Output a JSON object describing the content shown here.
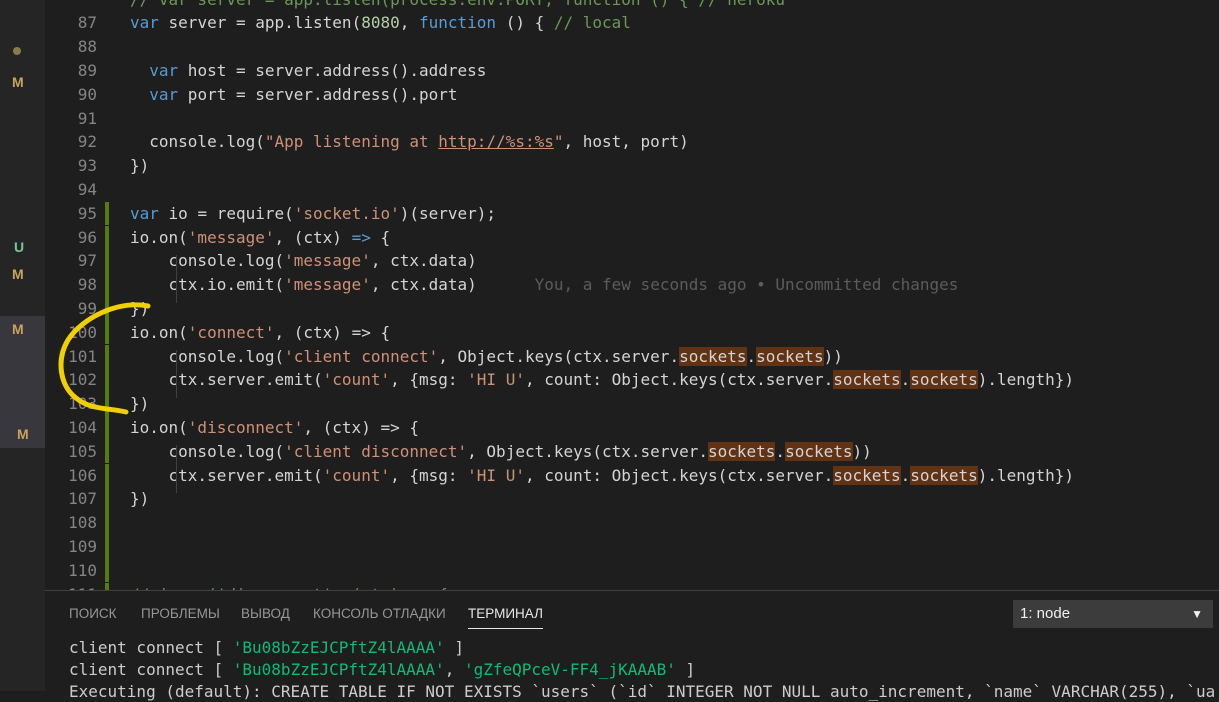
{
  "sidebar": {
    "badges": [
      {
        "label": "M",
        "color": "#c9a25b",
        "kind": "modified"
      },
      {
        "label": "U",
        "color": "#73c991",
        "kind": "untracked"
      },
      {
        "label": "M",
        "color": "#c9a25b",
        "kind": "modified"
      },
      {
        "label": "M",
        "color": "#c9a25b",
        "kind": "modified"
      },
      {
        "label": "M",
        "color": "#c9a25b",
        "kind": "modified"
      }
    ]
  },
  "editor": {
    "lines": [
      {
        "n": "",
        "segs": [
          {
            "t": "// var server = app.listen(process.env.PORT, function () { // heroku",
            "c": "cm"
          }
        ]
      },
      {
        "n": "87",
        "segs": [
          {
            "t": "var",
            "c": "kw"
          },
          {
            "t": " server = app.listen("
          },
          {
            "t": "8080",
            "c": "num"
          },
          {
            "t": ", "
          },
          {
            "t": "function",
            "c": "kw"
          },
          {
            "t": " () { "
          },
          {
            "t": "// local",
            "c": "cm"
          }
        ]
      },
      {
        "n": "88",
        "segs": []
      },
      {
        "n": "89",
        "segs": [
          {
            "t": "  "
          },
          {
            "t": "var",
            "c": "kw"
          },
          {
            "t": " host = server.address().address"
          }
        ]
      },
      {
        "n": "90",
        "segs": [
          {
            "t": "  "
          },
          {
            "t": "var",
            "c": "kw"
          },
          {
            "t": " port = server.address().port"
          }
        ]
      },
      {
        "n": "91",
        "segs": []
      },
      {
        "n": "92",
        "segs": [
          {
            "t": "  console.log("
          },
          {
            "t": "\"App listening at ",
            "c": "str"
          },
          {
            "t": "http://%s:%s",
            "c": "url"
          },
          {
            "t": "\"",
            "c": "str"
          },
          {
            "t": ", host, port)"
          }
        ]
      },
      {
        "n": "93",
        "segs": [
          {
            "t": "})"
          }
        ]
      },
      {
        "n": "94",
        "segs": []
      },
      {
        "n": "95",
        "segs": [
          {
            "t": "var",
            "c": "kw"
          },
          {
            "t": " io = require("
          },
          {
            "t": "'socket.io'",
            "c": "str"
          },
          {
            "t": ")(server);"
          }
        ],
        "gutter": true
      },
      {
        "n": "96",
        "segs": [
          {
            "t": "io.on("
          },
          {
            "t": "'message'",
            "c": "str"
          },
          {
            "t": ", (ctx) "
          },
          {
            "t": "=>",
            "c": "kw"
          },
          {
            "t": " {"
          }
        ],
        "gutter": true
      },
      {
        "n": "97",
        "segs": [
          {
            "t": "    console.log("
          },
          {
            "t": "'message'",
            "c": "str"
          },
          {
            "t": ", ctx.data)"
          }
        ],
        "gutter": true
      },
      {
        "n": "98",
        "segs": [
          {
            "t": "    ctx.io.emit("
          },
          {
            "t": "'message'",
            "c": "str"
          },
          {
            "t": ", ctx.data)"
          },
          {
            "t": "      You, a few seconds ago • Uncommitted changes",
            "c": "blame"
          }
        ],
        "gutter": true
      },
      {
        "n": "99",
        "segs": [
          {
            "t": "})"
          }
        ],
        "gutter": true
      },
      {
        "n": "100",
        "segs": [
          {
            "t": "io.on("
          },
          {
            "t": "'connect'",
            "c": "str"
          },
          {
            "t": ", (ctx) => {"
          }
        ],
        "gutter": true
      },
      {
        "n": "101",
        "segs": [
          {
            "t": "    console.log("
          },
          {
            "t": "'client connect'",
            "c": "str"
          },
          {
            "t": ", Object.keys(ctx.server."
          },
          {
            "t": "sockets",
            "c": "hl"
          },
          {
            "t": "."
          },
          {
            "t": "sockets",
            "c": "hl"
          },
          {
            "t": "))"
          }
        ],
        "gutter": true
      },
      {
        "n": "102",
        "segs": [
          {
            "t": "    ctx.server.emit("
          },
          {
            "t": "'count'",
            "c": "str"
          },
          {
            "t": ", {msg: "
          },
          {
            "t": "'HI U'",
            "c": "str"
          },
          {
            "t": ", count: Object.keys(ctx.server."
          },
          {
            "t": "sockets",
            "c": "hl"
          },
          {
            "t": "."
          },
          {
            "t": "sockets",
            "c": "hl"
          },
          {
            "t": ").length})"
          }
        ],
        "gutter": true
      },
      {
        "n": "103",
        "segs": [
          {
            "t": "})"
          }
        ],
        "gutter": true
      },
      {
        "n": "104",
        "segs": [
          {
            "t": "io.on("
          },
          {
            "t": "'disconnect'",
            "c": "str"
          },
          {
            "t": ", (ctx) => {"
          }
        ],
        "gutter": true
      },
      {
        "n": "105",
        "segs": [
          {
            "t": "    console.log("
          },
          {
            "t": "'client disconnect'",
            "c": "str"
          },
          {
            "t": ", Object.keys(ctx.server."
          },
          {
            "t": "sockets",
            "c": "hl"
          },
          {
            "t": "."
          },
          {
            "t": "sockets",
            "c": "hl"
          },
          {
            "t": "))"
          }
        ],
        "gutter": true
      },
      {
        "n": "106",
        "segs": [
          {
            "t": "    ctx.server.emit("
          },
          {
            "t": "'count'",
            "c": "str"
          },
          {
            "t": ", {msg: "
          },
          {
            "t": "'HI U'",
            "c": "str"
          },
          {
            "t": ", count: Object.keys(ctx.server."
          },
          {
            "t": "sockets",
            "c": "hl"
          },
          {
            "t": "."
          },
          {
            "t": "sockets",
            "c": "hl"
          },
          {
            "t": ").length})"
          }
        ],
        "gutter": true
      },
      {
        "n": "107",
        "segs": [
          {
            "t": "})"
          }
        ],
        "gutter": true
      },
      {
        "n": "108",
        "segs": [],
        "gutter": true
      },
      {
        "n": "109",
        "segs": [],
        "gutter": true
      },
      {
        "n": "110",
        "segs": [],
        "gutter": true
      },
      {
        "n": "111",
        "segs": [
          {
            "t": "// io.on('disconnect', (ctx) => {",
            "c": "cm"
          }
        ],
        "gutter": true
      }
    ]
  },
  "panel": {
    "tabs": [
      {
        "label": "ПОИСК",
        "active": false
      },
      {
        "label": "ПРОБЛЕМЫ",
        "active": false
      },
      {
        "label": "ВЫВОД",
        "active": false
      },
      {
        "label": "КОНСОЛЬ ОТЛАДКИ",
        "active": false
      },
      {
        "label": "ТЕРМИНАЛ",
        "active": true
      }
    ],
    "terminal_select": "1: node",
    "terminal_lines": [
      [
        {
          "t": "client connect [ "
        },
        {
          "t": "'Bu08bZzEJCPftZ4lAAAA'",
          "c": "tstr"
        },
        {
          "t": " ]"
        }
      ],
      [
        {
          "t": "client connect [ "
        },
        {
          "t": "'Bu08bZzEJCPftZ4lAAAA'",
          "c": "tstr"
        },
        {
          "t": ", "
        },
        {
          "t": "'gZfeQPceV-FF4_jKAAAB'",
          "c": "tstr"
        },
        {
          "t": " ]"
        }
      ],
      [
        {
          "t": "Executing (default): CREATE TABLE IF NOT EXISTS `users` (`id` INTEGER NOT NULL auto_increment, `name` VARCHAR(255), `ua"
        }
      ]
    ]
  }
}
